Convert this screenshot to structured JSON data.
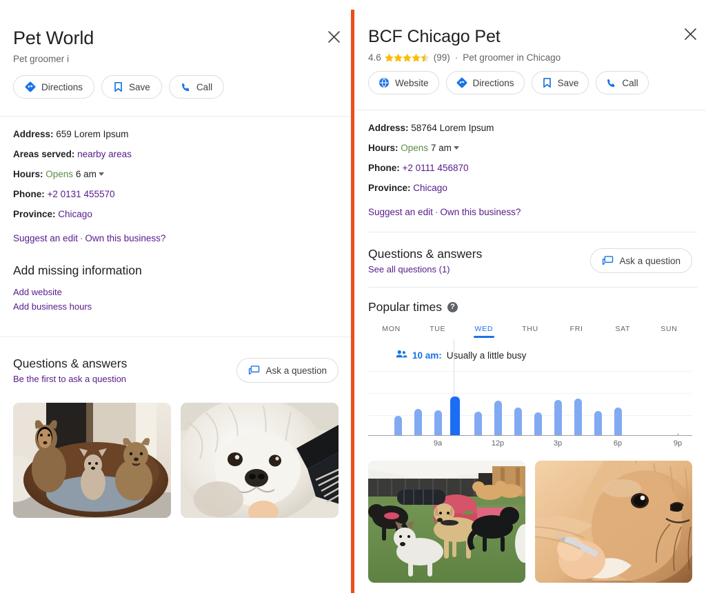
{
  "left_panel": {
    "title": "Pet World",
    "subtitle": "Pet groomer i",
    "close_label": "✕",
    "actions": [
      {
        "icon": "directions-icon",
        "label": "Directions"
      },
      {
        "icon": "bookmark-icon",
        "label": "Save"
      },
      {
        "icon": "phone-icon",
        "label": "Call"
      }
    ],
    "info": {
      "address_label": "Address:",
      "address_value": "659 Lorem Ipsum",
      "areas_label": "Areas served:",
      "areas_value": "nearby areas",
      "hours_label": "Hours:",
      "hours_state": "Opens",
      "hours_value": "6 am",
      "phone_label": "Phone:",
      "phone_value": "+2 0131 455570",
      "province_label": "Province:",
      "province_value": "Chicago"
    },
    "suggest_edit": "Suggest an edit",
    "edit_separator": "·",
    "own_business": "Own this business?",
    "add_missing": {
      "heading": "Add missing information",
      "links": [
        "Add website",
        "Add business hours"
      ]
    },
    "qa": {
      "heading": "Questions & answers",
      "sub": "Be the first to ask a question",
      "button": "Ask a question"
    },
    "photos": [
      {
        "alt": "three-small-dogs-in-a-wooden-bowl-bed"
      },
      {
        "alt": "white-shih-tzu-being-brushed-with-comb"
      }
    ]
  },
  "right_panel": {
    "title": "BCF Chicago Pet",
    "close_label": "✕",
    "rating": "4.6",
    "stars_filled": 4.5,
    "review_count": "(99)",
    "separator": "·",
    "category": "Pet groomer in Chicago",
    "actions": [
      {
        "icon": "globe-icon",
        "label": "Website"
      },
      {
        "icon": "directions-icon",
        "label": "Directions"
      },
      {
        "icon": "bookmark-icon",
        "label": "Save"
      },
      {
        "icon": "phone-icon",
        "label": "Call"
      }
    ],
    "info": {
      "address_label": "Address:",
      "address_value": "58764 Lorem Ipsum",
      "hours_label": "Hours:",
      "hours_state": "Opens",
      "hours_value": "7 am",
      "phone_label": "Phone:",
      "phone_value": "+2 0111 456870",
      "province_label": "Province:",
      "province_value": "Chicago"
    },
    "suggest_edit": "Suggest an edit",
    "edit_separator": "·",
    "own_business": "Own this business?",
    "qa": {
      "heading": "Questions & answers",
      "sub": "See all questions (1)",
      "button": "Ask a question"
    },
    "popular_times": {
      "heading": "Popular times",
      "help_glyph": "?",
      "status_time": "10 am:",
      "status_text": " Usually a little busy"
    },
    "photos": [
      {
        "alt": "group-of-dogs-playing-in-daycare-yard"
      },
      {
        "alt": "yorkshire-terrier-being-groomed-closeup"
      }
    ]
  },
  "colors": {
    "accent_bar": "#E8501A",
    "link_visited": "#551a8b",
    "link": "#1a0dab",
    "open_green": "#5b8c42",
    "google_blue": "#1a73e8",
    "bar_blue": "#81aaf2",
    "bar_current": "#1b6ef3",
    "star_gold": "#fbbc04"
  },
  "chart_data": {
    "type": "bar",
    "title": "Popular times",
    "days": [
      "MON",
      "TUE",
      "WED",
      "THU",
      "FRI",
      "SAT",
      "SUN"
    ],
    "active_day": "WED",
    "current_time_label": "10 am",
    "current_status": "Usually a little busy",
    "categories": [
      "6a",
      "7a",
      "8a",
      "9a",
      "10a",
      "11a",
      "12p",
      "1p",
      "2p",
      "3p",
      "4p",
      "5p",
      "6p",
      "7p",
      "8p",
      "9p",
      "10p",
      "11p"
    ],
    "x_tick_labels": [
      "9a",
      "12p",
      "3p",
      "6p",
      "9p"
    ],
    "x_tick_indices": [
      3,
      6,
      9,
      12,
      15
    ],
    "bars": [
      {
        "hour": "7a",
        "value": 28
      },
      {
        "hour": "8a",
        "value": 38
      },
      {
        "hour": "9a",
        "value": 36
      },
      {
        "hour": "10a",
        "value": 56,
        "current": true
      },
      {
        "hour": "11a",
        "value": 34
      },
      {
        "hour": "12p",
        "value": 50
      },
      {
        "hour": "1p",
        "value": 40
      },
      {
        "hour": "2p",
        "value": 33
      },
      {
        "hour": "3p",
        "value": 51
      },
      {
        "hour": "4p",
        "value": 53
      },
      {
        "hour": "5p",
        "value": 35
      },
      {
        "hour": "6p",
        "value": 40
      }
    ],
    "values": [
      28,
      38,
      36,
      56,
      34,
      50,
      40,
      33,
      51,
      53,
      35,
      40
    ],
    "ylim": [
      0,
      100
    ],
    "xlabel": "",
    "ylabel": "",
    "grid": true,
    "legend": "none"
  }
}
